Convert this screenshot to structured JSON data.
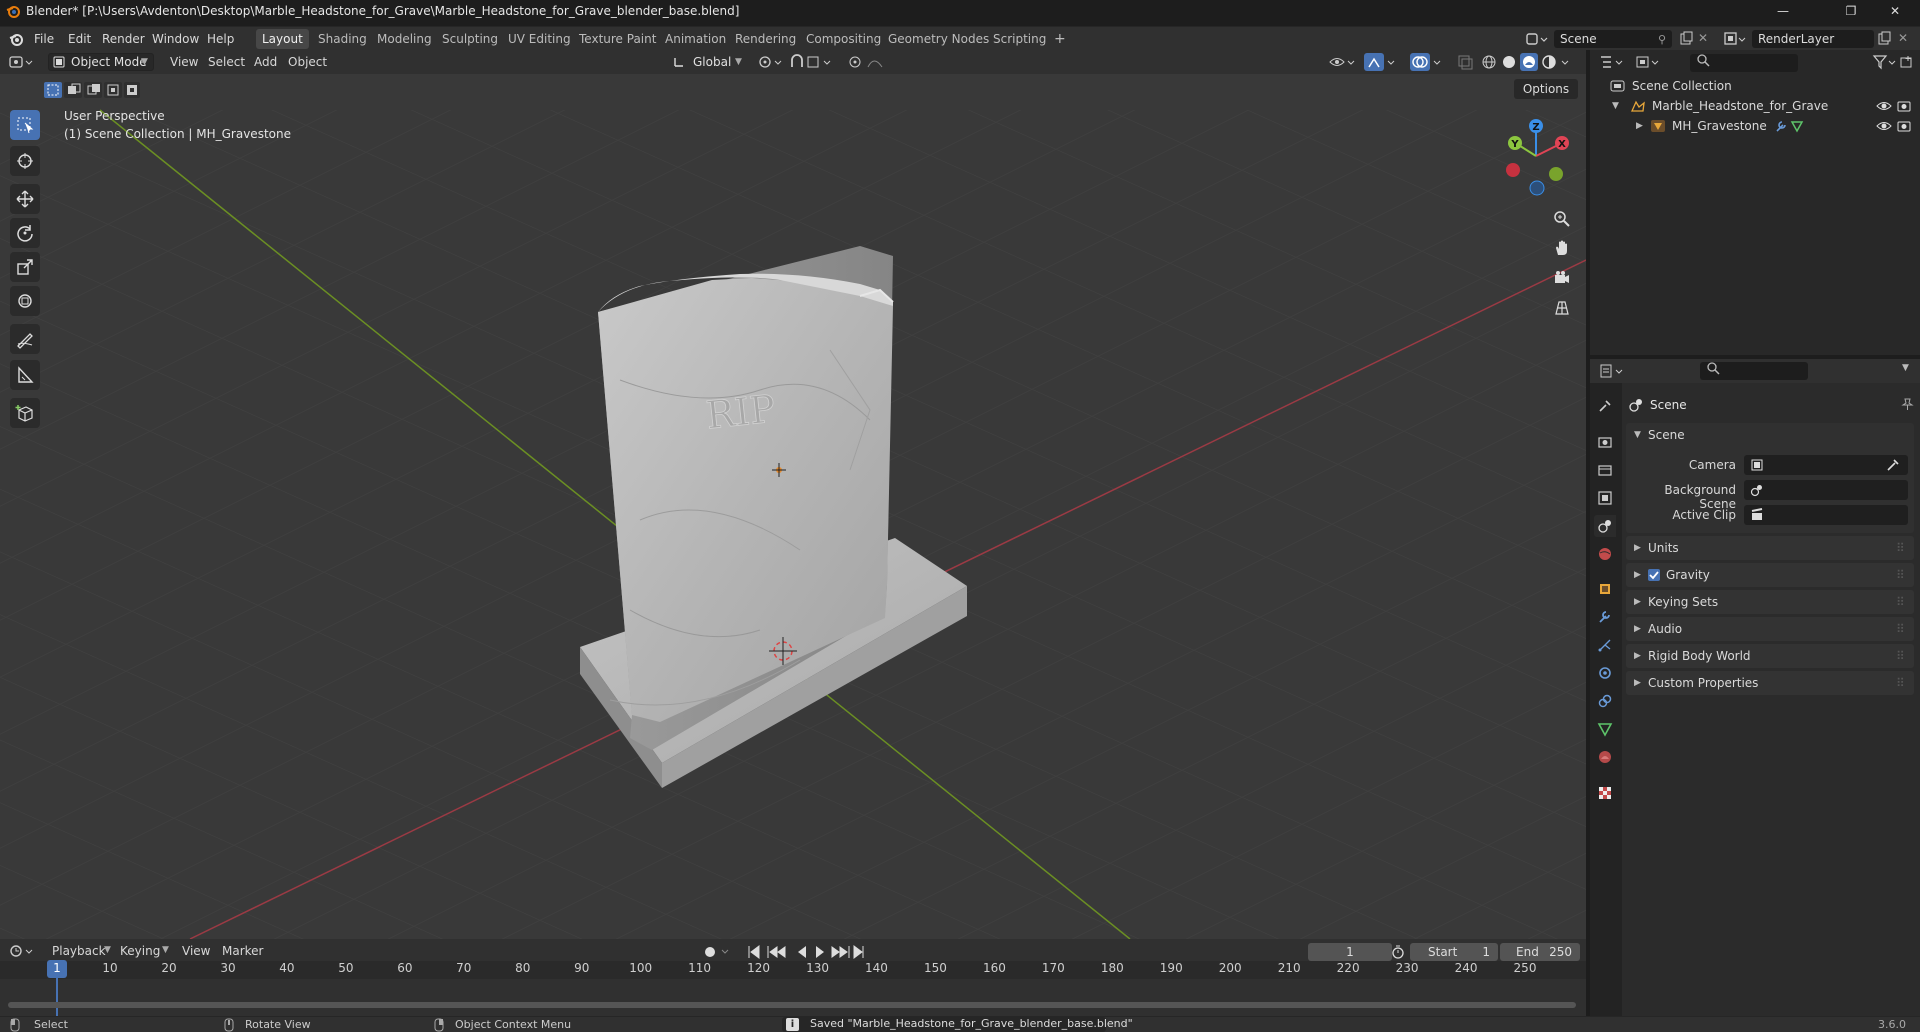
{
  "window": {
    "title": "Blender* [P:\\Users\\Avdenton\\Desktop\\Marble_Headstone_for_Grave\\Marble_Headstone_for_Grave_blender_base.blend]",
    "minimize": "—",
    "maximize": "❐",
    "close": "✕"
  },
  "menus": [
    "File",
    "Edit",
    "Render",
    "Window",
    "Help"
  ],
  "workspaces": [
    "Layout",
    "Shading",
    "Modeling",
    "Sculpting",
    "UV Editing",
    "Texture Paint",
    "Animation",
    "Rendering",
    "Compositing",
    "Geometry Nodes",
    "Scripting"
  ],
  "active_workspace": "Layout",
  "scene_field": "Scene",
  "renderlayer_field": "RenderLayer",
  "viewport": {
    "mode": "Object Mode",
    "menu": [
      "View",
      "Select",
      "Add",
      "Object"
    ],
    "orientation": "Global",
    "options_label": "Options",
    "overlay_line1": "User Perspective",
    "overlay_line2": "(1) Scene Collection | MH_Gravestone",
    "gizmo_axes": {
      "z": "Z",
      "y": "Y",
      "x": "X"
    },
    "engraving": "RIP"
  },
  "timeline": {
    "menu": [
      "Playback",
      "Keying",
      "View",
      "Marker"
    ],
    "current_frame": "1",
    "start_label": "Start",
    "start": "1",
    "end_label": "End",
    "end": "250",
    "ruler": [
      "1",
      "10",
      "20",
      "30",
      "40",
      "50",
      "60",
      "70",
      "80",
      "90",
      "100",
      "110",
      "120",
      "130",
      "140",
      "150",
      "160",
      "170",
      "180",
      "190",
      "200",
      "210",
      "220",
      "230",
      "240",
      "250"
    ]
  },
  "outliner": {
    "root": "Scene Collection",
    "items": [
      {
        "label": "Marble_Headstone_for_Grave",
        "type": "collection"
      },
      {
        "label": "MH_Gravestone",
        "type": "object"
      }
    ]
  },
  "properties": {
    "context": "Scene",
    "section": "Scene",
    "fields": [
      {
        "label": "Camera"
      },
      {
        "label": "Background Scene"
      },
      {
        "label": "Active Clip"
      }
    ],
    "panels": [
      "Units",
      "Gravity",
      "Keying Sets",
      "Audio",
      "Rigid Body World",
      "Custom Properties"
    ],
    "gravity_checked": true
  },
  "statusbar": {
    "select": "Select",
    "rotate": "Rotate View",
    "context_menu": "Object Context Menu",
    "message": "Saved \"Marble_Headstone_for_Grave_blender_base.blend\"",
    "version": "3.6.0"
  },
  "colors": {
    "accent": "#4772b3",
    "x_axis": "#e04455",
    "y_axis": "#8cc63f",
    "z_axis": "#3a8fe8",
    "collection": "#e8a73a",
    "object": "#e8a73a"
  }
}
